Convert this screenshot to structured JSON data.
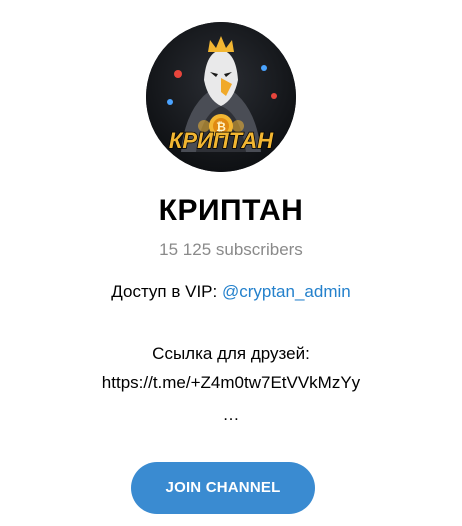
{
  "channel": {
    "avatar_text": "КРИПТАН",
    "title": "КРИПТАН",
    "subscribers": "15 125 subscribers"
  },
  "description": {
    "vip_prefix": "Доступ в VIP: ",
    "vip_link": "@cryptan_admin",
    "friends_label": "Ссылка для друзей:",
    "friends_link": "https://t.me/+Z4m0tw7EtVVkMzYy",
    "ellipsis": "…"
  },
  "actions": {
    "join_label": "JOIN CHANNEL"
  },
  "colors": {
    "accent": "#3a8bd1",
    "link": "#2481cc",
    "muted": "#8a8a8a",
    "avatar_bg": "#15171b",
    "avatar_text": "#f2b632"
  }
}
